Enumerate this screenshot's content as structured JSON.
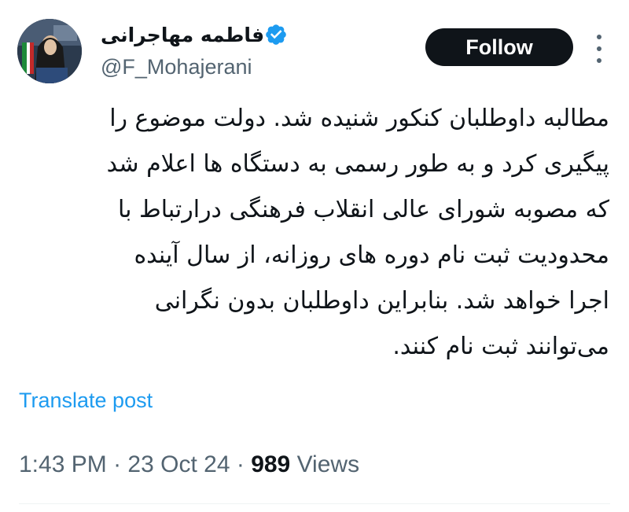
{
  "author": {
    "display_name": "فاطمه مهاجرانی",
    "handle": "@F_Mohajerani",
    "verified": true,
    "avatar_icon": "profile-photo"
  },
  "actions": {
    "follow_label": "Follow",
    "more_icon": "more-options-icon"
  },
  "post": {
    "text": "مطالبه داوطلبان کنکور شنیده شد. دولت موضوع را\nپیگیری کرد و به طور رسمی به دستگاه ها اعلام شد\nکه مصوبه شورای عالی انقلاب فرهنگی درارتباط با\nمحدودیت ثبت نام دوره های روزانه، از سال آینده\nاجرا خواهد شد. بنابراین داوطلبان بدون نگرانی\nمی‌توانند ثبت نام کنند.",
    "translate_label": "Translate post"
  },
  "meta": {
    "time": "1:43 PM",
    "separator": "·",
    "date": "23 Oct 24",
    "views_count": "989",
    "views_label": "Views"
  },
  "colors": {
    "text_primary": "#0f1419",
    "text_secondary": "#536471",
    "link": "#1d9bf0",
    "verified_badge": "#1d9bf0",
    "divider": "#eff3f4"
  }
}
